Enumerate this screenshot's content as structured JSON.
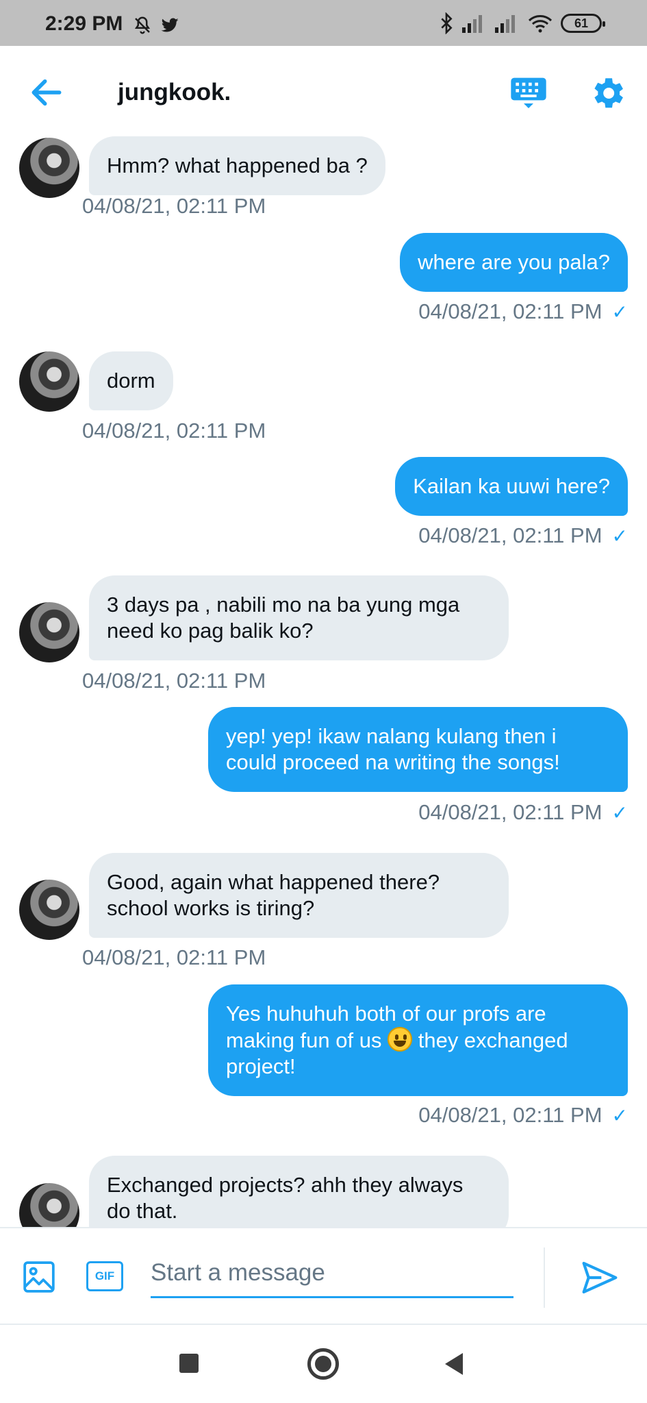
{
  "status_bar": {
    "time": "2:29 PM",
    "battery": "61",
    "icons": [
      "mute-icon",
      "twitter-icon",
      "bluetooth-icon",
      "signal-icon",
      "signal-icon",
      "wifi-icon",
      "battery-icon"
    ]
  },
  "header": {
    "title": "jungkook."
  },
  "messages": [
    {
      "from": "them",
      "text": "Hmm? what happened ba ?",
      "time": "04/08/21, 02:11 PM"
    },
    {
      "from": "me",
      "text": "where are you pala?",
      "time": "04/08/21, 02:11 PM"
    },
    {
      "from": "them",
      "text": "dorm",
      "time": "04/08/21, 02:11 PM"
    },
    {
      "from": "me",
      "text": "Kailan ka uuwi here?",
      "time": "04/08/21, 02:11 PM"
    },
    {
      "from": "them",
      "text_lines": [
        "3 days pa , nabili mo na ba yung mga",
        "need ko pag balik ko?"
      ],
      "time": "04/08/21, 02:11 PM"
    },
    {
      "from": "me",
      "text_lines": [
        "yep! yep! ikaw nalang kulang then i",
        "could proceed na writing the songs!"
      ],
      "time": "04/08/21, 02:11 PM"
    },
    {
      "from": "them",
      "text_lines": [
        "Good, again what happened there?",
        "school works is tiring?"
      ],
      "time": "04/08/21, 02:11 PM"
    },
    {
      "from": "me",
      "text_parts": [
        "Yes huhuhuh both of our profs are",
        "making fun of us",
        "they exchanged",
        "project!"
      ],
      "emoji": "grinning-face",
      "time": "04/08/21, 02:11 PM"
    },
    {
      "from": "them",
      "text_lines": [
        "Exchanged projects? ahh they always",
        "do that."
      ]
    }
  ],
  "composer": {
    "placeholder": "Start a message",
    "gif_label": "GIF"
  },
  "colors": {
    "accent": "#1da1f2",
    "incoming_bubble": "#e6ecf0",
    "timestamp": "#657786",
    "status_bar": "#bfbfbf"
  }
}
